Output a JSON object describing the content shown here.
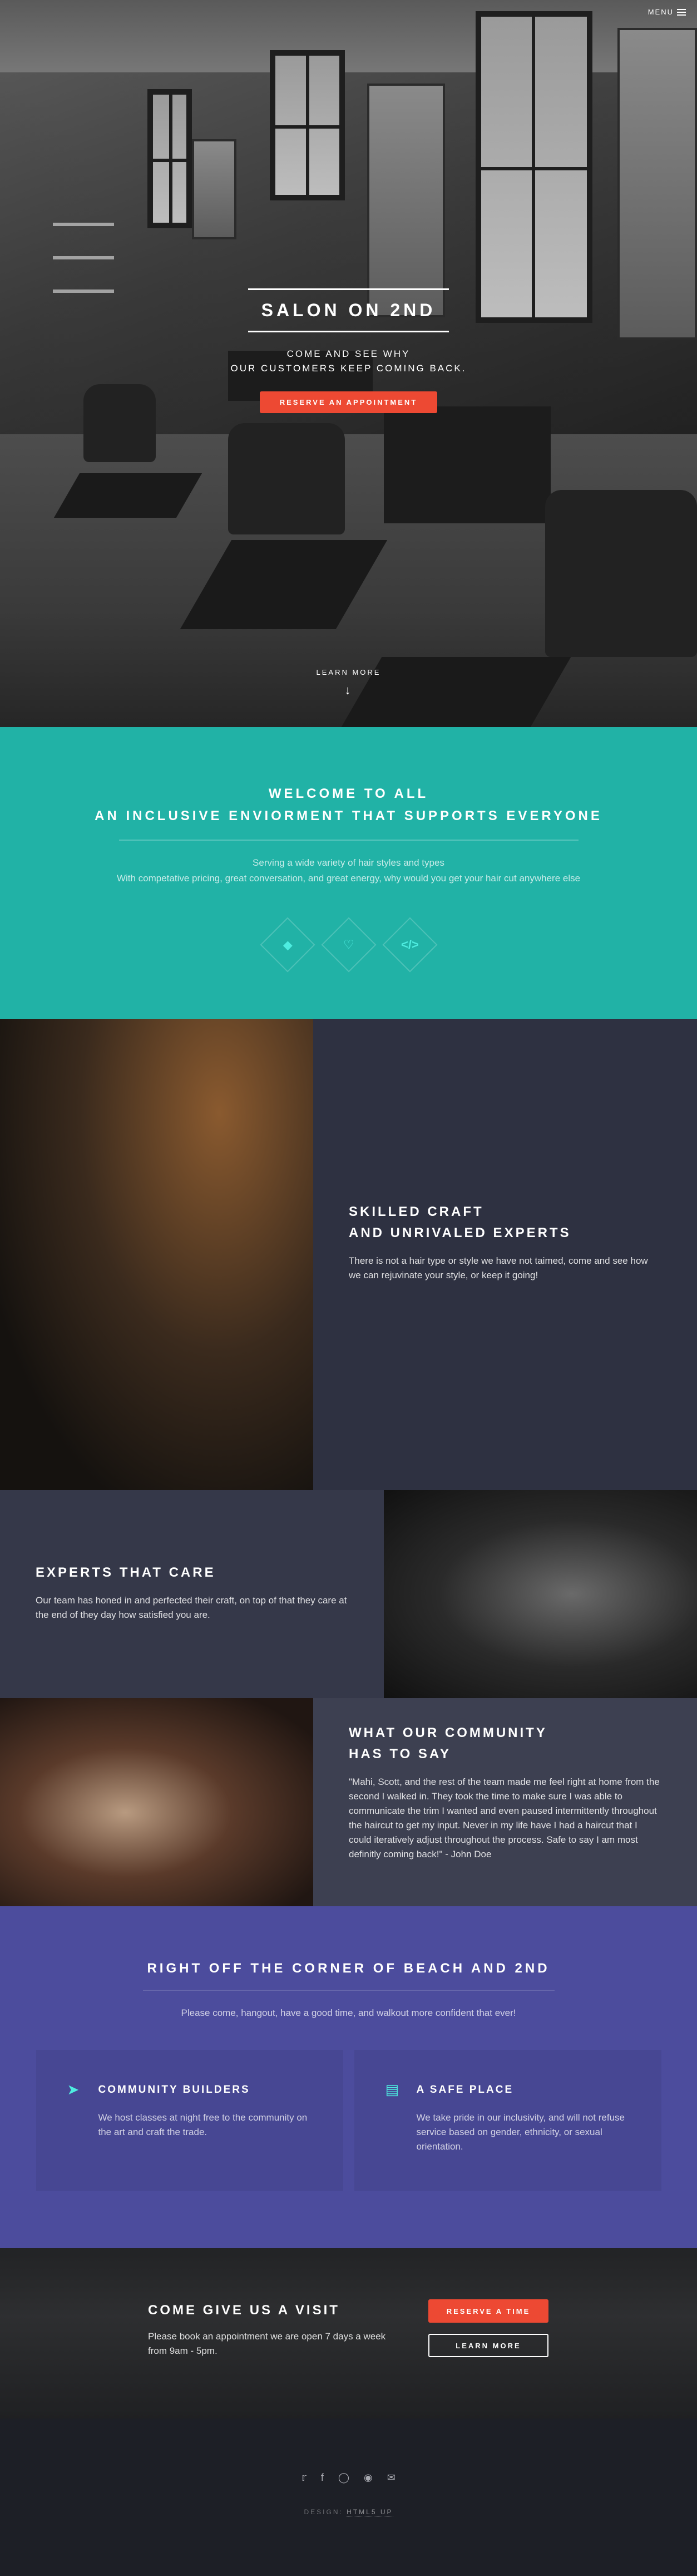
{
  "nav": {
    "menu_label": "MENU"
  },
  "hero": {
    "title": "SALON ON 2ND",
    "subtitle_line1": "COME AND SEE WHY",
    "subtitle_line2": "OUR CUSTOMERS KEEP COMING BACK.",
    "cta": "RESERVE AN APPOINTMENT",
    "learn_more": "LEARN MORE"
  },
  "welcome": {
    "title_line1": "WELCOME TO ALL",
    "title_line2": "AN INCLUSIVE ENVIORMENT THAT SUPPORTS EVERYONE",
    "text_line1": "Serving a wide variety of hair styles and types",
    "text_line2": "With competative pricing, great conversation, and great energy, why would you get your hair cut anywhere else",
    "icons": [
      "diamond-icon",
      "heart-icon",
      "code-icon"
    ]
  },
  "spotlights": [
    {
      "title_line1": "SKILLED CRAFT",
      "title_line2": "AND UNRIVALED EXPERTS",
      "text": "There is not a hair type or style we have not taimed, come and see how we can rejuvinate your style, or keep it going!"
    },
    {
      "title_line1": "EXPERTS THAT CARE",
      "title_line2": "",
      "text": "Our team has honed in and perfected their craft, on top of that they care at the end of they day how satisfied you are."
    },
    {
      "title_line1": "WHAT OUR COMMUNITY",
      "title_line2": "HAS TO SAY",
      "text": "\"Mahi, Scott, and the rest of the team made me feel right at home from the second I walked in. They took the time to make sure I was able to communicate the trim I wanted and even paused intermittently throughout the haircut to get my input. Never in my life have I had a haircut that I could iteratively adjust throughout the process. Safe to say I am most definitly coming back!\" - John Doe"
    }
  ],
  "corner": {
    "title": "RIGHT OFF THE CORNER OF BEACH AND 2ND",
    "text": "Please come, hangout, have a good time, and walkout more confident that ever!",
    "features": [
      {
        "icon": "paper-plane-icon",
        "title": "COMMUNITY BUILDERS",
        "text": "We host classes at night free to the community on the art and craft the trade."
      },
      {
        "icon": "laptop-icon",
        "title": "A SAFE PLACE",
        "text": "We take pride in our inclusivity, and will not refuse service based on gender, ethnicity, or sexual orientation."
      }
    ]
  },
  "visit": {
    "title": "COME GIVE US A VISIT",
    "text": "Please book an appointment we are open 7 days a week from 9am - 5pm.",
    "reserve_btn": "RESERVE A TIME",
    "learn_btn": "LEARN MORE"
  },
  "footer": {
    "social": [
      "twitter-icon",
      "facebook-icon",
      "instagram-icon",
      "dribbble-icon",
      "email-icon"
    ],
    "credits_prefix": "DESIGN: ",
    "credits_link": "HTML5 UP"
  },
  "colors": {
    "accent_red": "#ed4933",
    "teal": "#21b2a6",
    "icon_teal": "#4eede0",
    "purple": "#4c4c9d",
    "dark": "#2e3141"
  }
}
